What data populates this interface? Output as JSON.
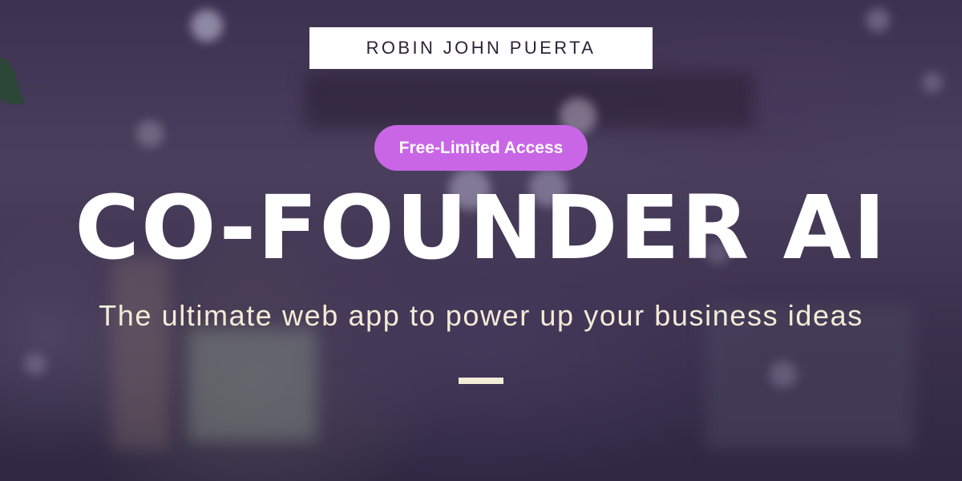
{
  "banner": {
    "author_name": "ROBIN JOHN PUERTA",
    "badge_label": "Free-Limited Access",
    "title": "CO-FOUNDER AI",
    "tagline": "The ultimate web app to power up your business ideas"
  },
  "colors": {
    "background": "#3f3452",
    "badge": "#c866e6",
    "title_text": "#ffffff",
    "tagline_text": "#f2ecd8",
    "name_box": "#ffffff"
  }
}
